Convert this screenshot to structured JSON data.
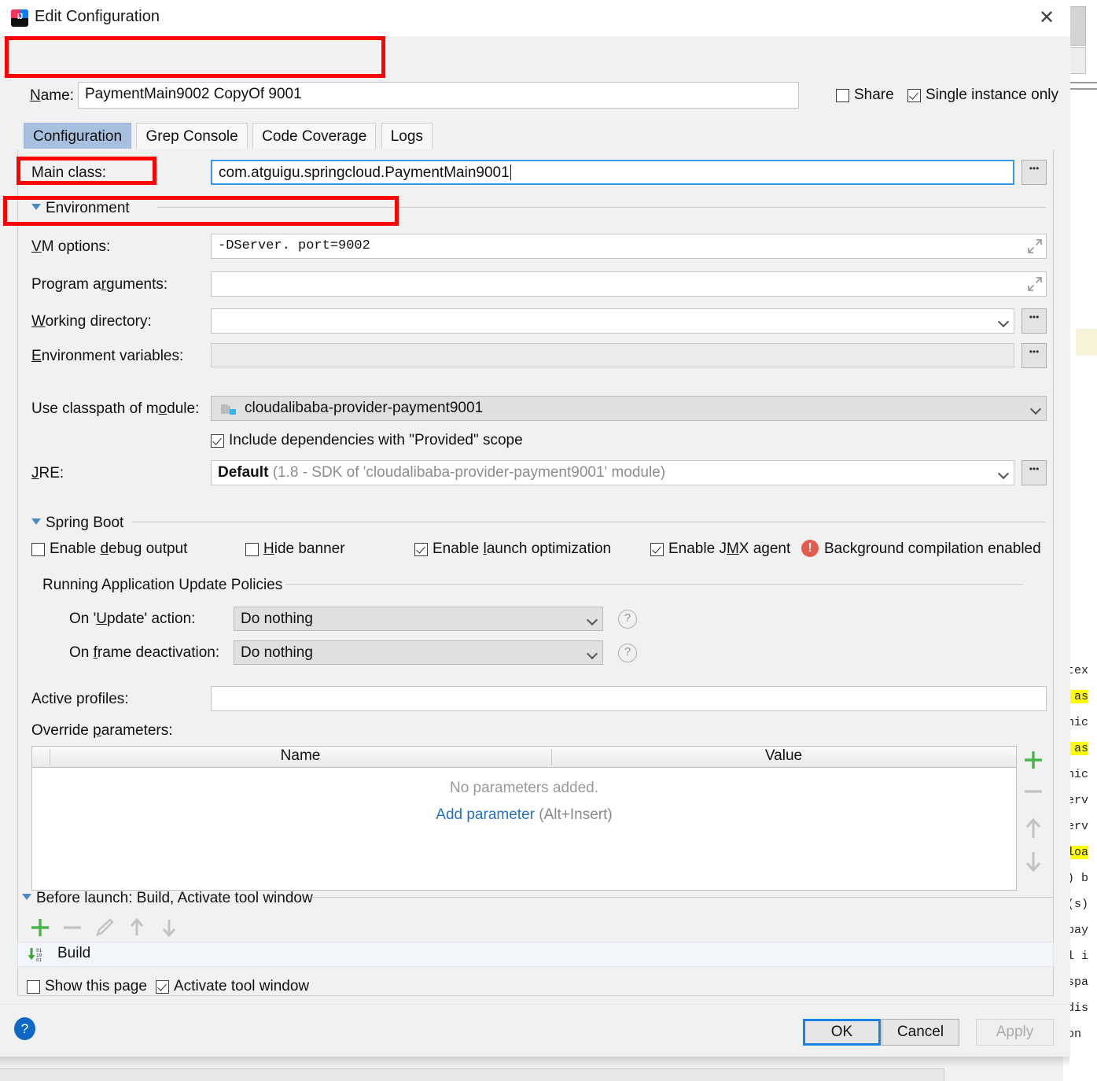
{
  "window": {
    "title": "Edit Configuration",
    "app_icon": "intellij-idea-icon",
    "close_icon": "close-icon"
  },
  "name_row": {
    "label": "Name:",
    "value": "PaymentMain9002 CopyOf 9001",
    "share_label": "Share",
    "share_checked": false,
    "single_instance_label": "Single instance only",
    "single_instance_checked": true
  },
  "tabs": [
    {
      "label": "Configuration",
      "active": true
    },
    {
      "label": "Grep Console",
      "active": false
    },
    {
      "label": "Code Coverage",
      "active": false
    },
    {
      "label": "Logs",
      "active": false
    }
  ],
  "configuration": {
    "main_class": {
      "label": "Main class:",
      "value": "com.atguigu.springcloud.PaymentMain9001",
      "browse_label": "..."
    },
    "environment_section": "Environment",
    "vm_options": {
      "label": "VM options:",
      "value": "-DServer. port=9002",
      "expand_icon": "expand-arrows-icon"
    },
    "program_arguments": {
      "label": "Program arguments:",
      "value": "",
      "expand_icon": "expand-arrows-icon"
    },
    "working_directory": {
      "label": "Working directory:",
      "value": "",
      "browse_label": "..."
    },
    "environment_variables": {
      "label": "Environment variables:",
      "value": "",
      "browse_label": "..."
    },
    "classpath": {
      "label": "Use classpath of module:",
      "value": "cloudalibaba-provider-payment9001",
      "module_icon": "module-folder-icon"
    },
    "include_provided": {
      "label": "Include dependencies with \"Provided\" scope",
      "checked": true
    },
    "jre": {
      "label": "JRE:",
      "value_bold": "Default",
      "value_grey": "(1.8 - SDK of 'cloudalibaba-provider-payment9001' module)",
      "browse_label": "..."
    }
  },
  "spring_boot": {
    "section": "Spring Boot",
    "checkboxes": [
      {
        "label": "Enable debug output",
        "checked": false
      },
      {
        "label": "Hide banner",
        "checked": false
      },
      {
        "label": "Enable launch optimization",
        "checked": true
      },
      {
        "label": "Enable JMX agent",
        "checked": true
      }
    ],
    "background_warning": {
      "icon": "warning-error-icon",
      "text": "Background compilation enabled"
    },
    "update_policies_title": "Running Application Update Policies",
    "on_update_action": {
      "label": "On 'Update' action:",
      "value": "Do nothing",
      "help_icon": "help-circle-icon"
    },
    "on_frame_deactivation": {
      "label": "On frame deactivation:",
      "value": "Do nothing",
      "help_icon": "help-circle-icon"
    },
    "active_profiles": {
      "label": "Active profiles:",
      "value": ""
    },
    "override_parameters": {
      "label": "Override parameters:",
      "columns": [
        "Name",
        "Value"
      ],
      "rows": [],
      "empty_text": "No parameters added.",
      "add_link": "Add parameter",
      "add_hint": "(Alt+Insert)",
      "toolbar": [
        {
          "icon": "plus-icon",
          "enabled": true
        },
        {
          "icon": "minus-icon",
          "enabled": false
        },
        {
          "icon": "arrow-up-icon",
          "enabled": false
        },
        {
          "icon": "arrow-down-icon",
          "enabled": false
        }
      ]
    }
  },
  "before_launch": {
    "section": "Before launch: Build, Activate tool window",
    "toolbar": [
      {
        "icon": "plus-icon",
        "enabled": true
      },
      {
        "icon": "minus-icon",
        "enabled": false
      },
      {
        "icon": "pencil-edit-icon",
        "enabled": false
      },
      {
        "icon": "arrow-up-icon",
        "enabled": false
      },
      {
        "icon": "arrow-down-icon",
        "enabled": false
      }
    ],
    "tasks": [
      {
        "icon": "build-compile-icon",
        "label": "Build"
      }
    ],
    "show_this_page": {
      "label": "Show this page",
      "checked": false
    },
    "activate_tool_window": {
      "label": "Activate tool window",
      "checked": true
    }
  },
  "footer": {
    "help_icon": "help-question-icon",
    "buttons": [
      {
        "label": "OK",
        "state": "primary"
      },
      {
        "label": "Cancel",
        "state": "normal"
      },
      {
        "label": "Apply",
        "state": "disabled"
      }
    ]
  },
  "annotations": {
    "color": "#ff0000",
    "boxes": [
      "name-row-highlight",
      "environment-section-highlight",
      "vm-options-highlight"
    ]
  },
  "background_editor": {
    "code_fragments": [
      "tex",
      " as",
      "nic",
      " as",
      "nic",
      "erv",
      "erv",
      "loa",
      ") b",
      "(s)",
      "pay",
      "l i",
      "spa",
      "dis",
      "on"
    ],
    "highlight_color": "#ffff00"
  }
}
